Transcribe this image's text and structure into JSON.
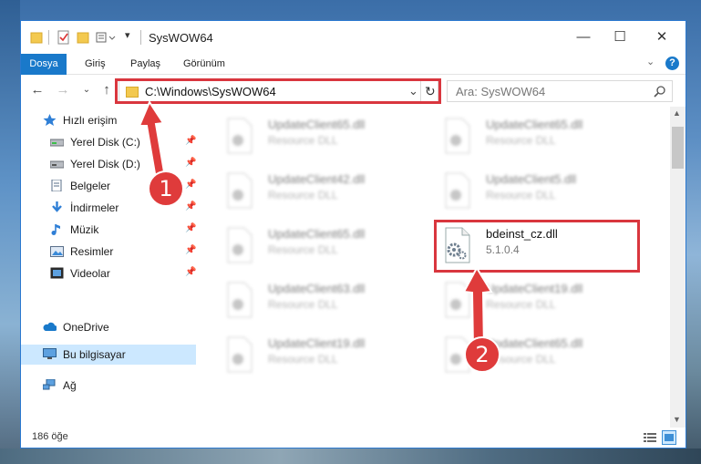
{
  "window": {
    "title": "SysWOW64",
    "controls": {
      "minimize": "—",
      "maximize": "☐",
      "close": "✕"
    }
  },
  "ribbon": {
    "tabs": [
      "Dosya",
      "Giriş",
      "Paylaş",
      "Görünüm"
    ]
  },
  "address_bar": {
    "path": "C:\\Windows\\SysWOW64",
    "refresh_glyph": "↻",
    "dropdown_glyph": "⌄"
  },
  "search": {
    "placeholder": "Ara: SysWOW64"
  },
  "sidebar": {
    "items": [
      {
        "label": "Hızlı erişim",
        "icon": "star-icon"
      },
      {
        "label": "Yerel Disk (C:)",
        "icon": "drive-icon",
        "pinned": true
      },
      {
        "label": "Yerel Disk (D:)",
        "icon": "drive-icon",
        "pinned": true
      },
      {
        "label": "Belgeler",
        "icon": "documents-icon",
        "pinned": true
      },
      {
        "label": "İndirmeler",
        "icon": "download-icon",
        "pinned": true
      },
      {
        "label": "Müzik",
        "icon": "music-icon",
        "pinned": true
      },
      {
        "label": "Resimler",
        "icon": "pictures-icon",
        "pinned": true
      },
      {
        "label": "Videolar",
        "icon": "video-icon",
        "pinned": true
      },
      {
        "label": "OneDrive",
        "icon": "cloud-icon"
      },
      {
        "label": "Bu bilgisayar",
        "icon": "computer-icon",
        "selected": true
      },
      {
        "label": "Ağ",
        "icon": "network-icon"
      }
    ]
  },
  "files": [
    {
      "name": "UpdateClient65.dll",
      "type": "Resource DLL"
    },
    {
      "name": "UpdateClient65.dll",
      "type": "Resource DLL"
    },
    {
      "name": "UpdateClient42.dll",
      "type": "Resource DLL"
    },
    {
      "name": "UpdateClient5.dll",
      "type": "Resource DLL"
    },
    {
      "name": "UpdateClient65.dll",
      "type": "Resource DLL"
    },
    {
      "name": "bdeinst_cz.dll",
      "type": "5.1.0.4"
    },
    {
      "name": "UpdateClient63.dll",
      "type": "Resource DLL"
    },
    {
      "name": "UpdateClient19.dll",
      "type": "Resource DLL"
    },
    {
      "name": "UpdateClient19.dll",
      "type": "Resource DLL"
    },
    {
      "name": "UpdateClient65.dll",
      "type": "Resource DLL"
    }
  ],
  "status": {
    "item_count": "186 öğe"
  },
  "annotations": {
    "badge_1": "1",
    "badge_2": "2",
    "highlight_color": "#d9363e"
  }
}
